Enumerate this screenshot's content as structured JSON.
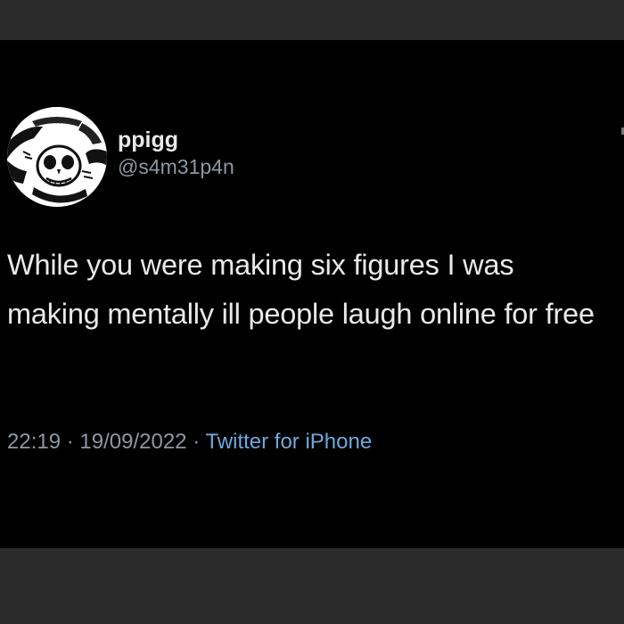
{
  "tweet": {
    "display_name": "ppigg",
    "handle": "@s4m31p4n",
    "text": "While you were making six figures I was making mentally ill people laugh online for free",
    "time": "22:19",
    "separator": "·",
    "date": "19/09/2022",
    "source": "Twitter for iPhone"
  },
  "colors": {
    "background": "#000000",
    "letterbox": "#2b2b2b",
    "text_primary": "#e7e9ea",
    "text_secondary": "#8b98a5",
    "link": "#6fa8dc"
  },
  "icons": {
    "avatar": "skull-profile-picture"
  }
}
